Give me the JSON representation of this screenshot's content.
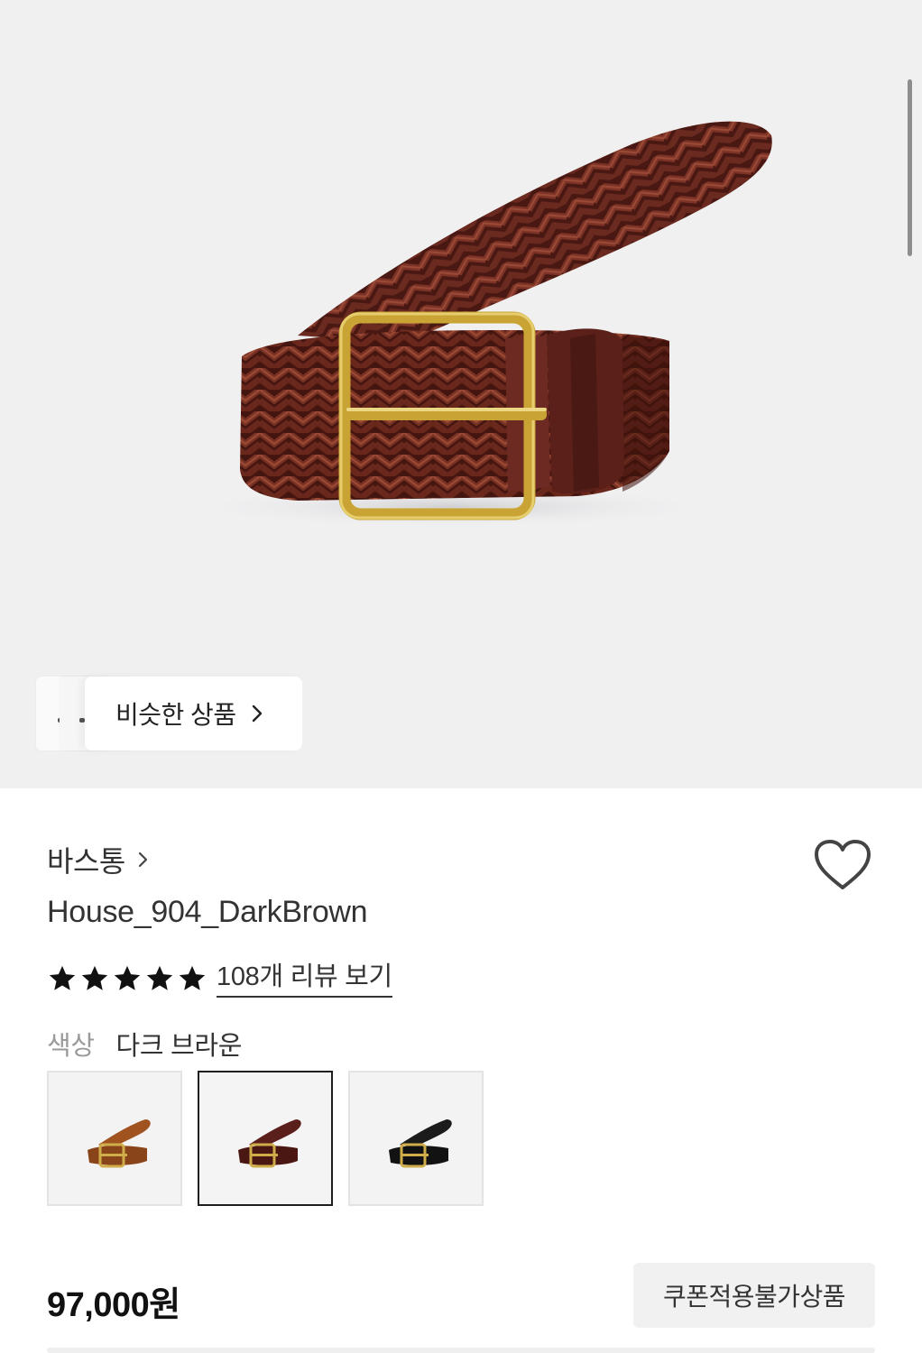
{
  "hero": {
    "image_icon": "braided-belt-image",
    "similar_button_label": "비슷한 상품"
  },
  "product": {
    "brand": "바스통",
    "name": "House_904_DarkBrown",
    "rating_stars": 5,
    "review_link": "108개 리뷰 보기",
    "color_key": "색상",
    "color_value": "다크 브라운",
    "swatches": [
      {
        "name": "tan-brown",
        "color": "#a0521f",
        "selected": false
      },
      {
        "name": "dark-brown",
        "color": "#5a1f1a",
        "selected": true
      },
      {
        "name": "black",
        "color": "#151515",
        "selected": false
      }
    ],
    "price": "97,000원",
    "coupon_badge": "쿠폰적용불가상품"
  },
  "colors": {
    "hero_bg": "#f0f0f1",
    "belt_leather": "#5b231c",
    "buckle_gold": "#c9a435"
  }
}
